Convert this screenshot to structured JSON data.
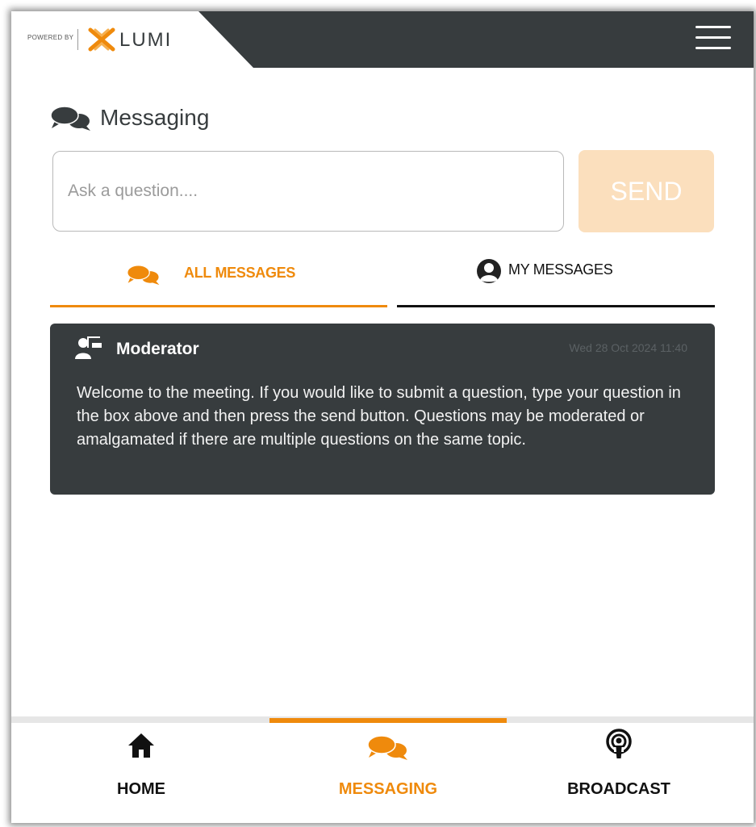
{
  "header": {
    "powered_by": "POWERED BY",
    "brand": "LUMI",
    "menu_icon": "hamburger-menu-icon"
  },
  "messaging": {
    "title": "Messaging",
    "title_icon": "chat-bubbles-icon",
    "input_placeholder": "Ask a question....",
    "send_label": "SEND"
  },
  "tabs": [
    {
      "label": "ALL MESSAGES",
      "icon": "chat-bubbles-icon",
      "active": true
    },
    {
      "label": "MY MESSAGES",
      "icon": "user-circle-icon",
      "active": false
    }
  ],
  "messages": [
    {
      "author": "Moderator",
      "author_icon": "presenter-icon",
      "timestamp": "Wed 28 Oct 2024 11:40",
      "text": "Welcome to the meeting. If you would like to submit a question, type your question in the box above and then press the send button. Questions may be moderated or amalgamated if there are multiple questions on the same topic."
    }
  ],
  "bottom_nav": [
    {
      "label": "HOME",
      "icon": "home-icon",
      "active": false
    },
    {
      "label": "MESSAGING",
      "icon": "chat-bubbles-icon",
      "active": true
    },
    {
      "label": "BROADCAST",
      "icon": "podcast-icon",
      "active": false
    }
  ],
  "colors": {
    "accent": "#ef8a0c",
    "header_bg": "#373c3e",
    "card_bg": "#373c3e",
    "send_disabled": "#fbdfbd"
  }
}
